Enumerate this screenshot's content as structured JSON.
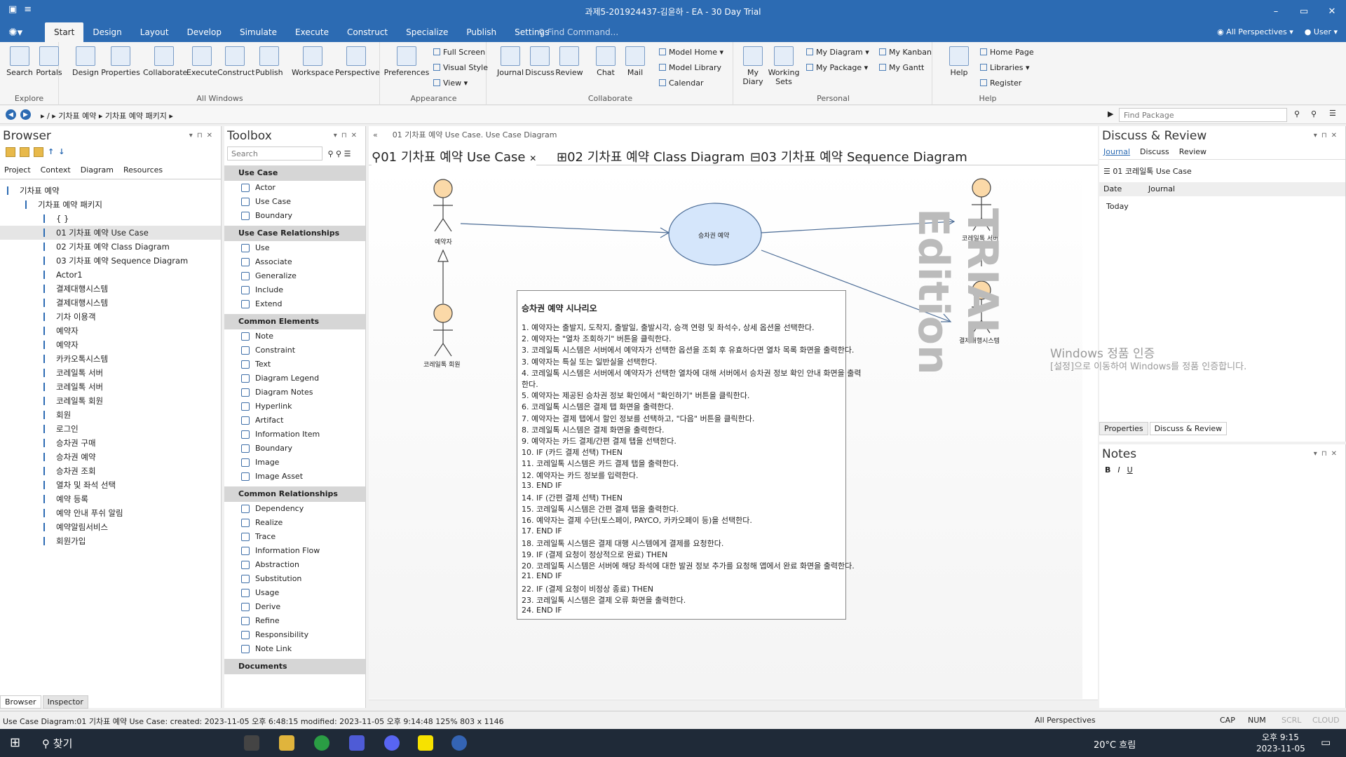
{
  "window": {
    "title": "과제5-201924437-김윤하 - EA - 30 Day Trial",
    "controls": [
      "–",
      "▭",
      "✕"
    ]
  },
  "menu": {
    "tabs": [
      "Start",
      "Design",
      "Layout",
      "Develop",
      "Simulate",
      "Execute",
      "Construct",
      "Specialize",
      "Publish",
      "Settings"
    ],
    "active": "Start",
    "find_placeholder": "Find Command...",
    "perspectives": "All Perspectives",
    "user": "User"
  },
  "ribbon": {
    "explore": {
      "buttons": [
        "Search",
        "Portals"
      ],
      "label": "Explore"
    },
    "allwindows": {
      "buttons": [
        "Design",
        "Properties",
        "Collaborate",
        "Execute",
        "Construct",
        "Publish",
        "Workspace",
        "Perspective"
      ],
      "label": "All Windows"
    },
    "appearance": {
      "buttons": [
        "Preferences"
      ],
      "small": [
        "Full Screen",
        "Visual Style",
        "View"
      ],
      "label": "Appearance"
    },
    "collaborate": {
      "buttons": [
        "Journal",
        "Discuss",
        "Review",
        "Chat",
        "Mail"
      ],
      "small": [
        "Model Home",
        "Model Library",
        "Calendar"
      ],
      "label": "Collaborate"
    },
    "personal": {
      "buttons": [
        "My Diary",
        "Working Sets"
      ],
      "small": [
        "My Diagram",
        "My Package",
        "My Kanban",
        "My Gantt"
      ],
      "label": "Personal"
    },
    "help": {
      "buttons": [
        "Help"
      ],
      "small": [
        "Home Page",
        "Libraries",
        "Register"
      ],
      "label": "Help"
    }
  },
  "address": {
    "crumbs": [
      "/",
      "기차표 예약",
      "기차표 예약 패키지"
    ],
    "find_package": "Find Package"
  },
  "browser": {
    "title": "Browser",
    "tabs": [
      "Project",
      "Context",
      "Diagram",
      "Resources"
    ],
    "tree": [
      {
        "label": "기차표 예약",
        "indent": 0,
        "sel": false
      },
      {
        "label": "기차표 예약 패키지",
        "indent": 1,
        "sel": false
      },
      {
        "label": "{ }",
        "indent": 2,
        "sel": false
      },
      {
        "label": "01 기차표 예약 Use Case",
        "indent": 2,
        "sel": true
      },
      {
        "label": "02 기차표 예약 Class Diagram",
        "indent": 2,
        "sel": false
      },
      {
        "label": "03 기차표 예약 Sequence Diagram",
        "indent": 2,
        "sel": false
      },
      {
        "label": "Actor1",
        "indent": 2,
        "sel": false
      },
      {
        "label": "결제대행시스템",
        "indent": 2,
        "sel": false
      },
      {
        "label": "결제대행시스템",
        "indent": 2,
        "sel": false
      },
      {
        "label": "기차 이용객",
        "indent": 2,
        "sel": false
      },
      {
        "label": "예약자",
        "indent": 2,
        "sel": false
      },
      {
        "label": "예약자",
        "indent": 2,
        "sel": false
      },
      {
        "label": "카카오톡시스템",
        "indent": 2,
        "sel": false
      },
      {
        "label": "코레일톡 서버",
        "indent": 2,
        "sel": false
      },
      {
        "label": "코레일톡 서버",
        "indent": 2,
        "sel": false
      },
      {
        "label": "코레일톡 회원",
        "indent": 2,
        "sel": false
      },
      {
        "label": "회원",
        "indent": 2,
        "sel": false
      },
      {
        "label": "로그인",
        "indent": 2,
        "sel": false
      },
      {
        "label": "승차권 구매",
        "indent": 2,
        "sel": false
      },
      {
        "label": "승차권 예약",
        "indent": 2,
        "sel": false
      },
      {
        "label": "승차권 조회",
        "indent": 2,
        "sel": false
      },
      {
        "label": "열차 및 좌석 선택",
        "indent": 2,
        "sel": false
      },
      {
        "label": "예약 등록",
        "indent": 2,
        "sel": false
      },
      {
        "label": "예약 안내 푸쉬 알림",
        "indent": 2,
        "sel": false
      },
      {
        "label": "예약알림서비스",
        "indent": 2,
        "sel": false
      },
      {
        "label": "회원가입",
        "indent": 2,
        "sel": false
      }
    ],
    "bottom_tabs": [
      "Browser",
      "Inspector"
    ]
  },
  "toolbox": {
    "title": "Toolbox",
    "search": "Search",
    "sections": [
      {
        "name": "Use Case",
        "items": [
          "Actor",
          "Use Case",
          "Boundary"
        ]
      },
      {
        "name": "Use Case Relationships",
        "items": [
          "Use",
          "Associate",
          "Generalize",
          "Include",
          "Extend"
        ]
      },
      {
        "name": "Common Elements",
        "items": [
          "Note",
          "Constraint",
          "Text",
          "Diagram Legend",
          "Diagram Notes",
          "Hyperlink",
          "Artifact",
          "Information Item",
          "Boundary",
          "Image",
          "Image Asset"
        ]
      },
      {
        "name": "Common Relationships",
        "items": [
          "Dependency",
          "Realize",
          "Trace",
          "Information Flow",
          "Abstraction",
          "Substitution",
          "Usage",
          "Derive",
          "Refine",
          "Responsibility",
          "Note Link"
        ]
      },
      {
        "name": "Documents",
        "items": []
      }
    ]
  },
  "diagram": {
    "path": "01 기차표 예약 Use Case.  Use Case Diagram",
    "tabs": [
      "01 기차표 예약 Use Case",
      "02 기차표 예약 Class Diagram",
      "03 기차표 예약 Sequence Diagram"
    ],
    "actors": {
      "a1": "예약자",
      "a2": "코레일톡 회원",
      "a3": "코레일톡 서버",
      "a4": "결제대행시스템"
    },
    "usecase": "승차권 예약",
    "note_title": "승차권 예약 시나리오",
    "note_lines": [
      "1. 예약자는 출발지, 도착지, 출발일, 출발시각, 승객 연령 및 좌석수, 상세 옵션을 선택한다.",
      "2. 예약자는 \"열차 조회하기\" 버튼을 클릭한다.",
      "3. 코레일톡 시스템은 서버에서 예약자가 선택한 옵션을 조회 후 유효하다면 열차 목록 화면을 출력한다.",
      "3. 예약자는 특실 또는 일반실을 선택한다.",
      "4. 코레일톡 시스템은 서버에서 예약자가 선택한 열차에 대해 서버에서 승차권 정보 확인 안내 화면을 출력",
      "한다.",
      "5. 예약자는 제공된 승차권 정보 확인에서 \"확인하기\" 버튼을 클릭한다.",
      "6. 코레일톡 시스템은  결제 탭 화면을 출력한다.",
      "7. 예약자는 결제 탭에서 할인 정보를 선택하고, \"다음\" 버튼을 클릭한다.",
      "8. 코레일톡 시스템은 결제 화면을 출력한다.",
      "9. 예약자는 카드 결제/간편 결제 탭을 선택한다.",
      "10. IF (카드 결제 선택) THEN",
      "11.    코레일톡 시스템은 카드 결제 탭을 출력한다.",
      "12.    예약자는 카드 정보를 입력한다.",
      "13. END IF",
      "14. IF (간편 결제 선택) THEN",
      "15.    코레일톡 시스템은 간편 결제 탭을 출력한다.",
      "16.    예약자는 결제 수단(토스페이, PAYCO, 카카오페이 등)을 선택한다.",
      "17. END IF",
      "18. 코레일톡 시스템은 결제 대행 시스템에게 결제를 요청한다.",
      "19. IF (결제 요청이 정상적으로 완료) THEN",
      "20.    코레일톡 시스템은 서버에 해당 좌석에 대한 발권 정보 추가를 요청해 앱에서 완료 화면을 출력한다.",
      "21. END IF",
      "22. IF (결제 요청이 비정상 종료) THEN",
      "23.    코레일톡 시스템은 결제 오류 화면을 출력한다.",
      "24. END IF"
    ],
    "watermark": "TRIAL Edition"
  },
  "discuss": {
    "title": "Discuss & Review",
    "tabs": [
      "Journal",
      "Discuss",
      "Review"
    ],
    "element": "01 코레일톡 Use Case",
    "cols": [
      "Date",
      "Journal"
    ],
    "today": "Today",
    "bottom_tabs": [
      "Properties",
      "Discuss & Review"
    ]
  },
  "notes": {
    "title": "Notes",
    "tools": [
      "B",
      "I",
      "U"
    ]
  },
  "status": {
    "left": "Use Case Diagram:01 기차표 예약 Use Case:  created: 2023-11-05 오후 6:48:15  modified: 2023-11-05 오후 9:14:48   125%   803 x 1146",
    "persp": "All Perspectives",
    "keys": [
      "CAP",
      "NUM",
      "SCRL",
      "CLOUD"
    ]
  },
  "activation": {
    "l1": "Windows 정품 인증",
    "l2": "[설정]으로 이동하여 Windows를 정품 인증합니다."
  },
  "taskbar": {
    "search": "찾기",
    "weather": "20°C 흐림",
    "time": "오후 9:15",
    "date": "2023-11-05"
  }
}
